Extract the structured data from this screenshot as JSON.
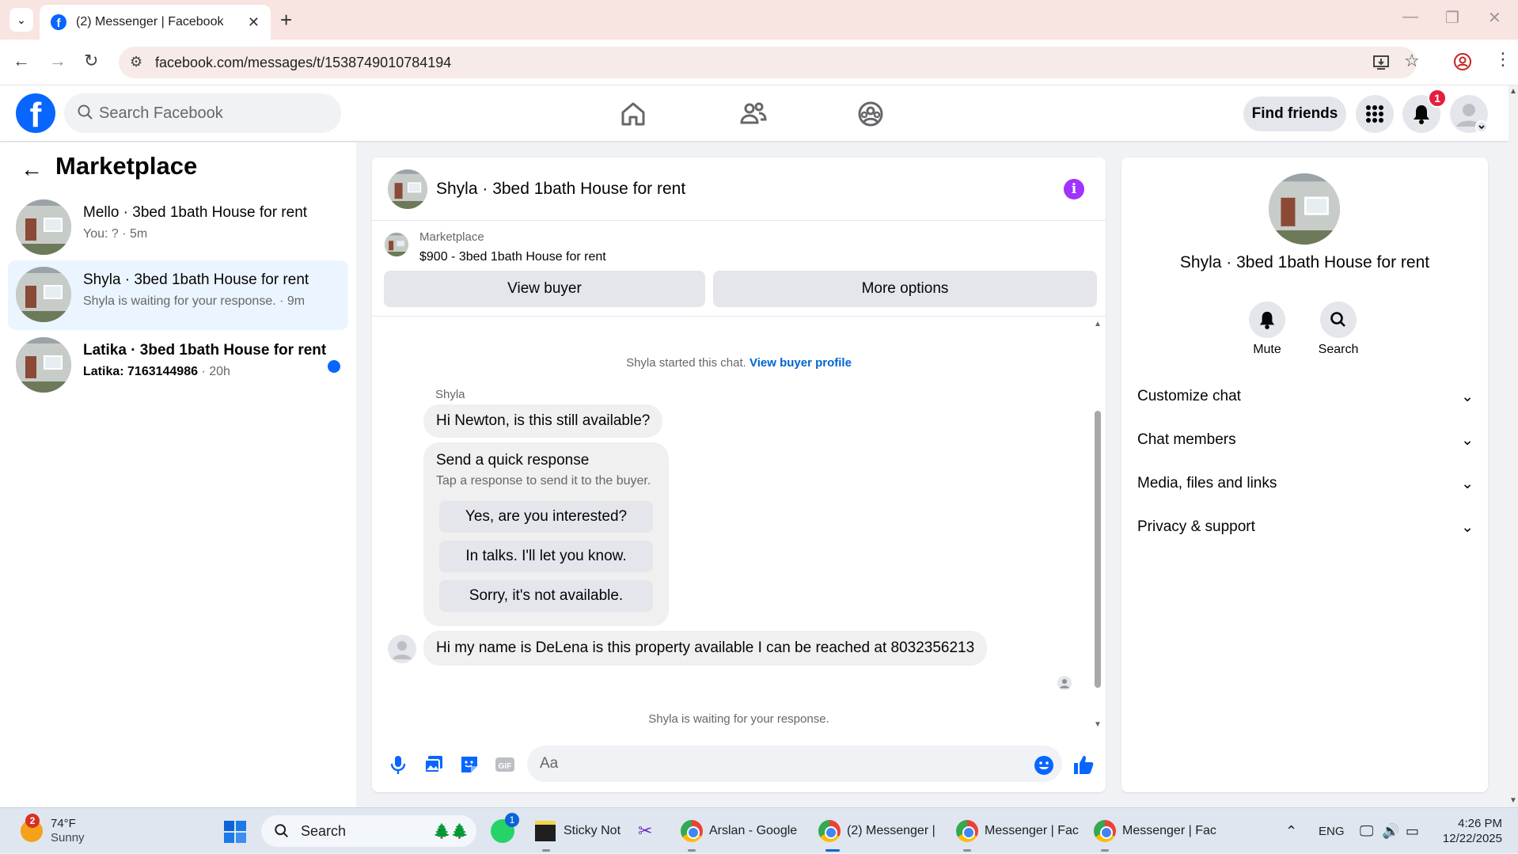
{
  "browser": {
    "tab_title": "(2) Messenger | Facebook",
    "url": "facebook.com/messages/t/1538749010784194"
  },
  "header": {
    "search_placeholder": "Search Facebook",
    "find_friends": "Find friends",
    "notification_count": "1"
  },
  "left": {
    "title": "Marketplace",
    "conversations": [
      {
        "name": "Mello · 3bed 1bath House for rent",
        "sub": "You: ? · 5m"
      },
      {
        "name": "Shyla · 3bed 1bath House for rent",
        "sub": "Shyla is waiting for your response. · 9m"
      },
      {
        "name": "Latika · 3bed 1bath House for rent",
        "sub_strong": "Latika: 7163144986",
        "sub_time": " · 20h"
      }
    ]
  },
  "chat": {
    "title": "Shyla · 3bed 1bath House for rent",
    "listing_source": "Marketplace",
    "listing_price_title": "$900 - 3bed 1bath House for rent",
    "view_buyer": "View buyer",
    "more_options": "More options",
    "started_text": "Shyla started this chat.",
    "view_buyer_profile": "View buyer profile",
    "sender_name": "Shyla",
    "msg1": "Hi Newton, is this still available?",
    "quick_response_title": "Send a quick response",
    "quick_response_sub": "Tap a response to send it to the buyer.",
    "quick_responses": [
      "Yes, are you interested?",
      "In talks. I'll let you know.",
      "Sorry, it's not available."
    ],
    "msg2": "Hi my name is DeLena is this property available I can be reached at 8032356213",
    "waiting_text": "Shyla is waiting for your response.",
    "input_placeholder": "Aa"
  },
  "right": {
    "name": "Shyla · 3bed 1bath House for rent",
    "mute": "Mute",
    "search": "Search",
    "sections": [
      "Customize chat",
      "Chat members",
      "Media, files and links",
      "Privacy & support"
    ]
  },
  "taskbar": {
    "weather_badge": "2",
    "temp": "74°F",
    "weather": "Sunny",
    "search": "Search",
    "whatsapp_badge": "1",
    "sticky": "Sticky Not",
    "app1": "Arslan - Google",
    "app2": "(2) Messenger |",
    "app3": "Messenger | Fac",
    "app4": "Messenger | Fac",
    "lang": "ENG",
    "time": "4:26 PM",
    "date": "12/22/2025"
  }
}
